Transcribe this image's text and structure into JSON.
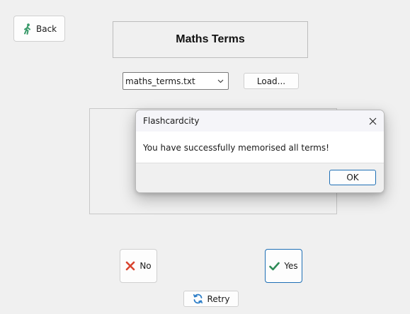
{
  "header": {
    "back_label": "Back",
    "title": "Maths Terms"
  },
  "file": {
    "selected": "maths_terms.txt",
    "load_label": "Load..."
  },
  "answer": {
    "no_label": "No",
    "yes_label": "Yes",
    "retry_label": "Retry"
  },
  "dialog": {
    "title": "Flashcardcity",
    "message": "You have successfully memorised all terms!",
    "ok_label": "OK"
  },
  "icons": {
    "back": "walking-person-icon",
    "dropdown": "chevron-down-icon",
    "no": "red-x-icon",
    "yes": "green-check-icon",
    "retry": "refresh-icon",
    "close": "close-icon"
  },
  "colors": {
    "background": "#f0f0f0",
    "accent_border": "#1e6fb5",
    "no_icon": "#d9442f",
    "yes_icon": "#2e8b57",
    "back_icon": "#3a9a6a",
    "retry_icon": "#2a7cc7"
  }
}
